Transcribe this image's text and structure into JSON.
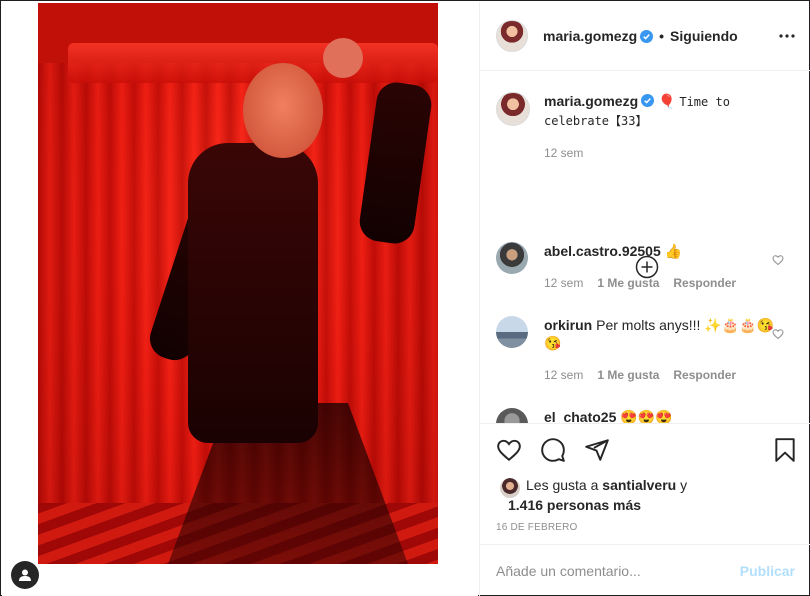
{
  "post": {
    "username": "maria.gomezg",
    "separator": "•",
    "follow_status": "Siguiendo",
    "caption_emoji": "🎈",
    "caption_text": "Time to celebrate【33】",
    "caption_time": "12 sem"
  },
  "comments": [
    {
      "username": "abel.castro.92505",
      "text": "👍",
      "time": "12 sem",
      "likes": "1 Me gusta",
      "reply": "Responder"
    },
    {
      "username": "orkirun",
      "text": "Per molts anys!!! ✨🎂🎂😘😘",
      "time": "12 sem",
      "likes": "1 Me gusta",
      "reply": "Responder"
    },
    {
      "username": "el_chato25",
      "text": "😍😍😍"
    }
  ],
  "likes": {
    "prefix": "Les gusta a ",
    "user": "santialveru",
    "suffix": " y",
    "others": "1.416 personas más"
  },
  "date": "16 DE FEBRERO",
  "composer": {
    "placeholder": "Añade un comentario...",
    "publish": "Publicar"
  },
  "colors": {
    "accent": "#0095f6",
    "publish_disabled": "#b2dffc",
    "verified": "#3897f0"
  }
}
